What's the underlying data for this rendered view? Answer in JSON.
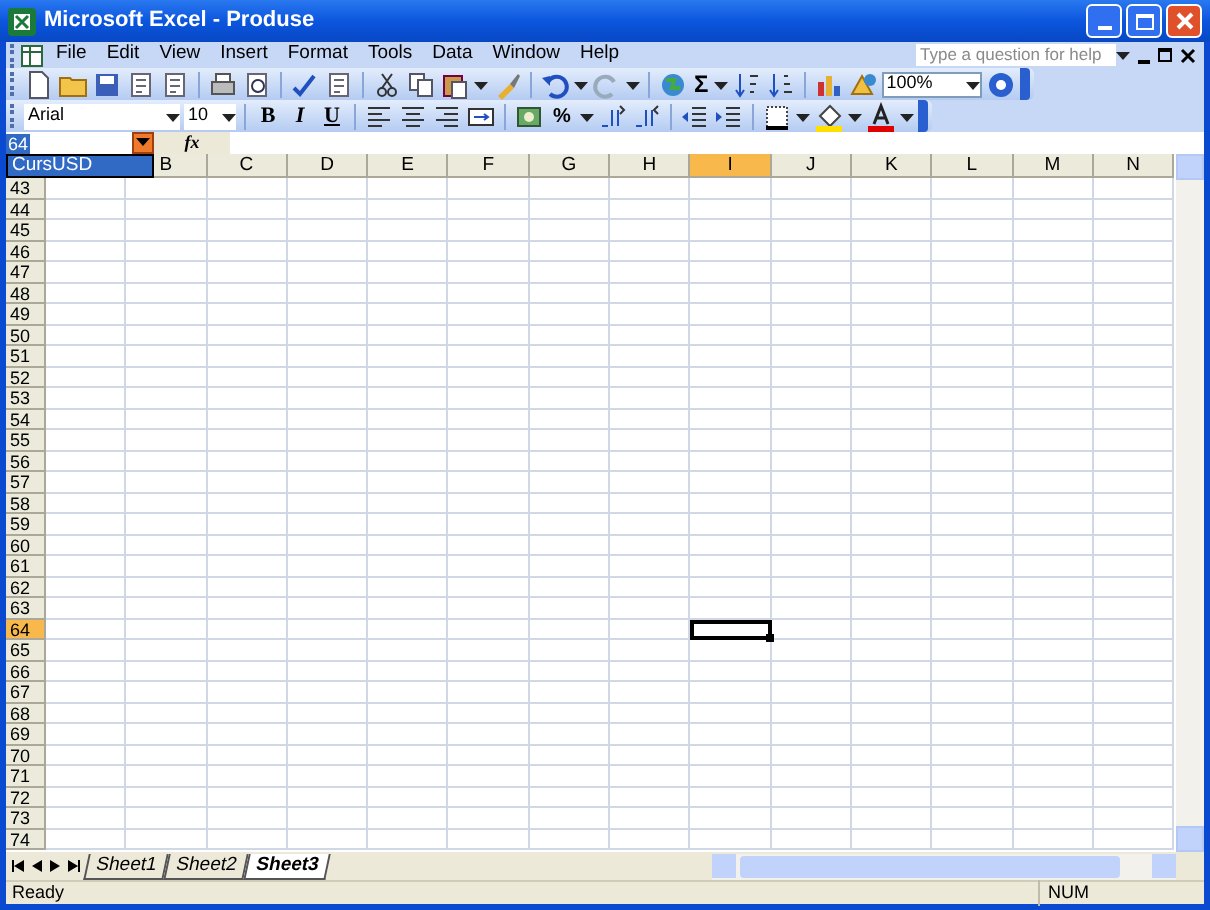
{
  "window": {
    "title": "Microsoft Excel - Produse"
  },
  "menu": [
    "File",
    "Edit",
    "View",
    "Insert",
    "Format",
    "Tools",
    "Data",
    "Window",
    "Help"
  ],
  "help_box": {
    "placeholder": "Type a question for help"
  },
  "standard_toolbar": {
    "sum": "Σ",
    "zoom": "100%"
  },
  "formatting_toolbar": {
    "font": "Arial",
    "size": "10",
    "bold": "B",
    "italic": "I",
    "underline": "U",
    "percent": "%"
  },
  "formula_bar": {
    "name_box": "64",
    "fx": "fx",
    "name_list": [
      {
        "label": "CursUSD",
        "selected": true
      }
    ]
  },
  "columns": [
    {
      "label": "B",
      "selected": false
    },
    {
      "label": "C",
      "selected": false
    },
    {
      "label": "D",
      "selected": false
    },
    {
      "label": "E",
      "selected": false
    },
    {
      "label": "F",
      "selected": false
    },
    {
      "label": "G",
      "selected": false
    },
    {
      "label": "H",
      "selected": false
    },
    {
      "label": "I",
      "selected": true
    },
    {
      "label": "J",
      "selected": false
    },
    {
      "label": "K",
      "selected": false
    },
    {
      "label": "L",
      "selected": false
    },
    {
      "label": "M",
      "selected": false
    },
    {
      "label": "N",
      "selected": false
    }
  ],
  "rows": [
    {
      "label": "43",
      "selected": false
    },
    {
      "label": "44",
      "selected": false
    },
    {
      "label": "45",
      "selected": false
    },
    {
      "label": "46",
      "selected": false
    },
    {
      "label": "47",
      "selected": false
    },
    {
      "label": "48",
      "selected": false
    },
    {
      "label": "49",
      "selected": false
    },
    {
      "label": "50",
      "selected": false
    },
    {
      "label": "51",
      "selected": false
    },
    {
      "label": "52",
      "selected": false
    },
    {
      "label": "53",
      "selected": false
    },
    {
      "label": "54",
      "selected": false
    },
    {
      "label": "55",
      "selected": false
    },
    {
      "label": "56",
      "selected": false
    },
    {
      "label": "57",
      "selected": false
    },
    {
      "label": "58",
      "selected": false
    },
    {
      "label": "59",
      "selected": false
    },
    {
      "label": "60",
      "selected": false
    },
    {
      "label": "61",
      "selected": false
    },
    {
      "label": "62",
      "selected": false
    },
    {
      "label": "63",
      "selected": false
    },
    {
      "label": "64",
      "selected": true
    },
    {
      "label": "65",
      "selected": false
    },
    {
      "label": "66",
      "selected": false
    },
    {
      "label": "67",
      "selected": false
    },
    {
      "label": "68",
      "selected": false
    },
    {
      "label": "69",
      "selected": false
    },
    {
      "label": "70",
      "selected": false
    },
    {
      "label": "71",
      "selected": false
    },
    {
      "label": "72",
      "selected": false
    },
    {
      "label": "73",
      "selected": false
    },
    {
      "label": "74",
      "selected": false
    }
  ],
  "sheet_tabs": [
    {
      "label": "Sheet1",
      "selected": false
    },
    {
      "label": "Sheet2",
      "selected": false
    },
    {
      "label": "Sheet3",
      "selected": true
    }
  ],
  "status_bar": {
    "status": "Ready",
    "indicator": "NUM"
  }
}
